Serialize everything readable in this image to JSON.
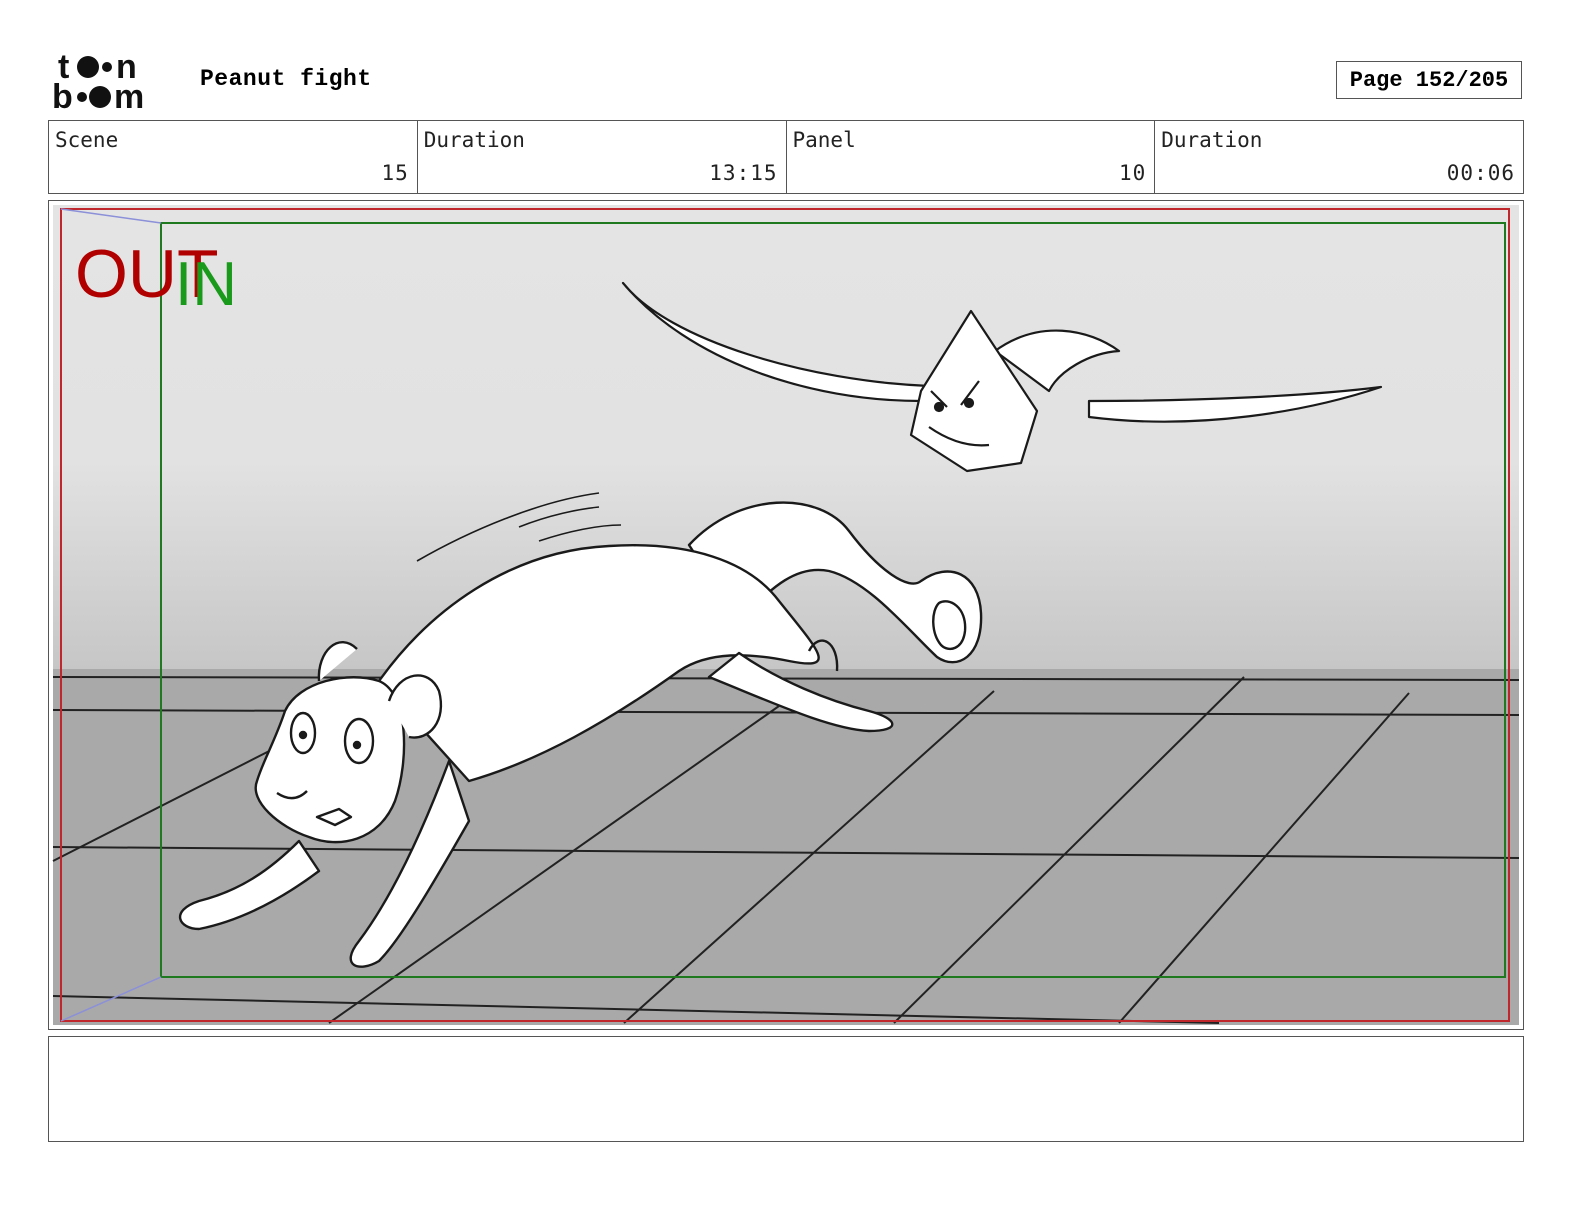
{
  "header": {
    "logo_text": "toonboom",
    "project_title": "Peanut fight",
    "page_label": "Page 152/205"
  },
  "info": [
    {
      "label": "Scene",
      "value": "15"
    },
    {
      "label": "Duration",
      "value": "13:15"
    },
    {
      "label": "Panel",
      "value": "10"
    },
    {
      "label": "Duration",
      "value": "00:06"
    }
  ],
  "panel": {
    "out_label": "OUT",
    "in_label": "IN",
    "out_color": "#b00000",
    "in_color": "#1a9a1a"
  },
  "caption": {
    "text": ""
  }
}
